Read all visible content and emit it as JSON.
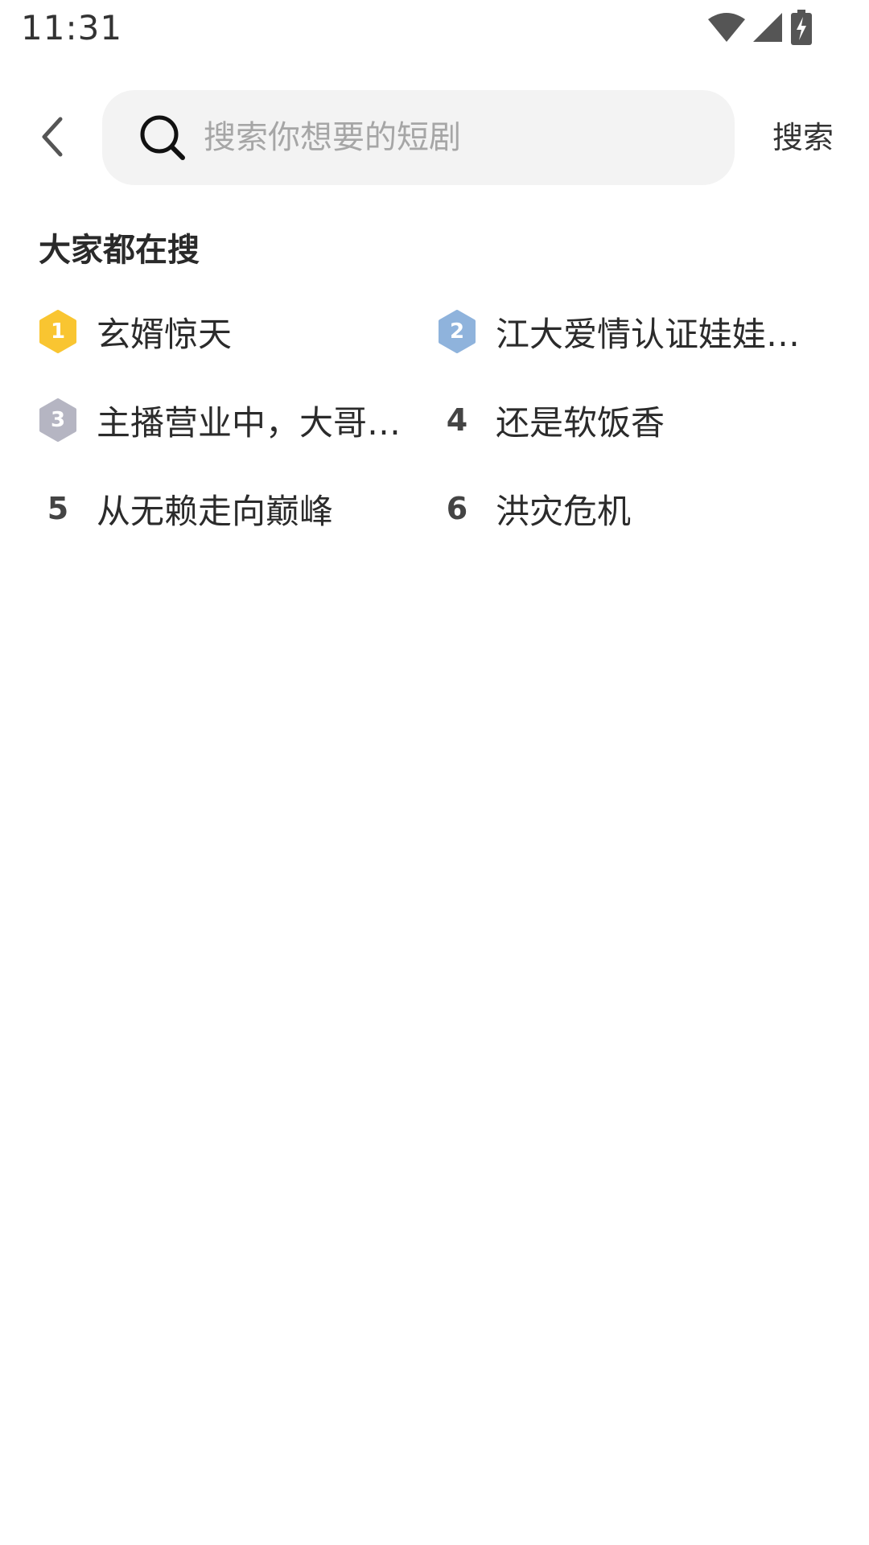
{
  "status_bar": {
    "time": "11:31",
    "icons": [
      "wifi-icon",
      "signal-icon",
      "battery-charging-icon"
    ]
  },
  "header": {
    "back_icon": "chevron-left-icon",
    "search_icon": "search-icon",
    "search_placeholder": "搜索你想要的短剧",
    "search_value": "",
    "search_button_label": "搜索"
  },
  "trending": {
    "title": "大家都在搜",
    "items": [
      {
        "rank": "1",
        "label": "玄婿惊天",
        "badge_color": "#f9c531"
      },
      {
        "rank": "2",
        "label": "江大爱情认证娃娃…",
        "badge_color": "#8fb3dc"
      },
      {
        "rank": "3",
        "label": "主播营业中，大哥…",
        "badge_color": "#b5b5c2"
      },
      {
        "rank": "4",
        "label": "还是软饭香"
      },
      {
        "rank": "5",
        "label": "从无赖走向巅峰"
      },
      {
        "rank": "6",
        "label": "洪灾危机"
      }
    ]
  }
}
